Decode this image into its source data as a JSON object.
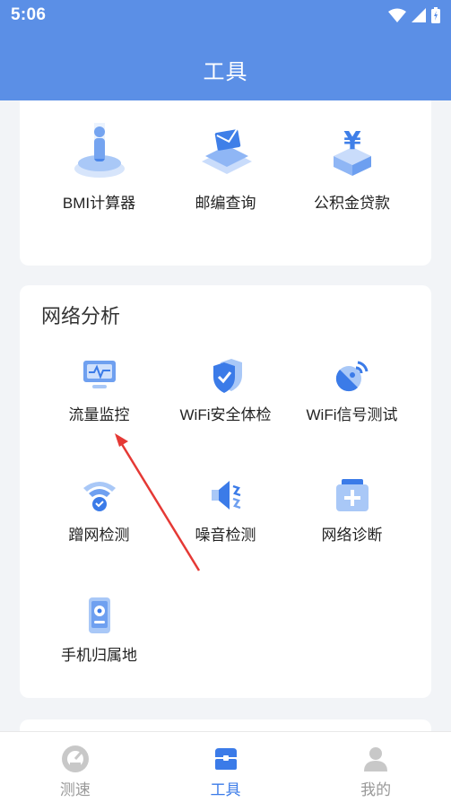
{
  "status": {
    "time": "5:06"
  },
  "header": {
    "title": "工具"
  },
  "tools_top": [
    {
      "label": "BMI计算器",
      "icon": "bmi-person-icon"
    },
    {
      "label": "邮编查询",
      "icon": "postcode-envelope-icon"
    },
    {
      "label": "公积金贷款",
      "icon": "yuan-fund-icon"
    }
  ],
  "network": {
    "title": "网络分析",
    "items": [
      {
        "label": "流量监控",
        "icon": "traffic-monitor-icon"
      },
      {
        "label": "WiFi安全体检",
        "icon": "wifi-security-shield-icon"
      },
      {
        "label": "WiFi信号测试",
        "icon": "wifi-signal-dish-icon"
      },
      {
        "label": "蹭网检测",
        "icon": "wifi-leech-icon"
      },
      {
        "label": "噪音检测",
        "icon": "noise-speaker-icon"
      },
      {
        "label": "网络诊断",
        "icon": "network-diagnosis-kit-icon"
      },
      {
        "label": "手机归属地",
        "icon": "phone-location-icon"
      }
    ]
  },
  "bottom_nav": [
    {
      "label": "测速",
      "icon": "speedometer-icon"
    },
    {
      "label": "工具",
      "icon": "toolbox-icon",
      "active": true
    },
    {
      "label": "我的",
      "icon": "profile-icon"
    }
  ],
  "colors": {
    "header": "#5b8fe6",
    "accent": "#3b7be8",
    "inactive": "#999999"
  }
}
